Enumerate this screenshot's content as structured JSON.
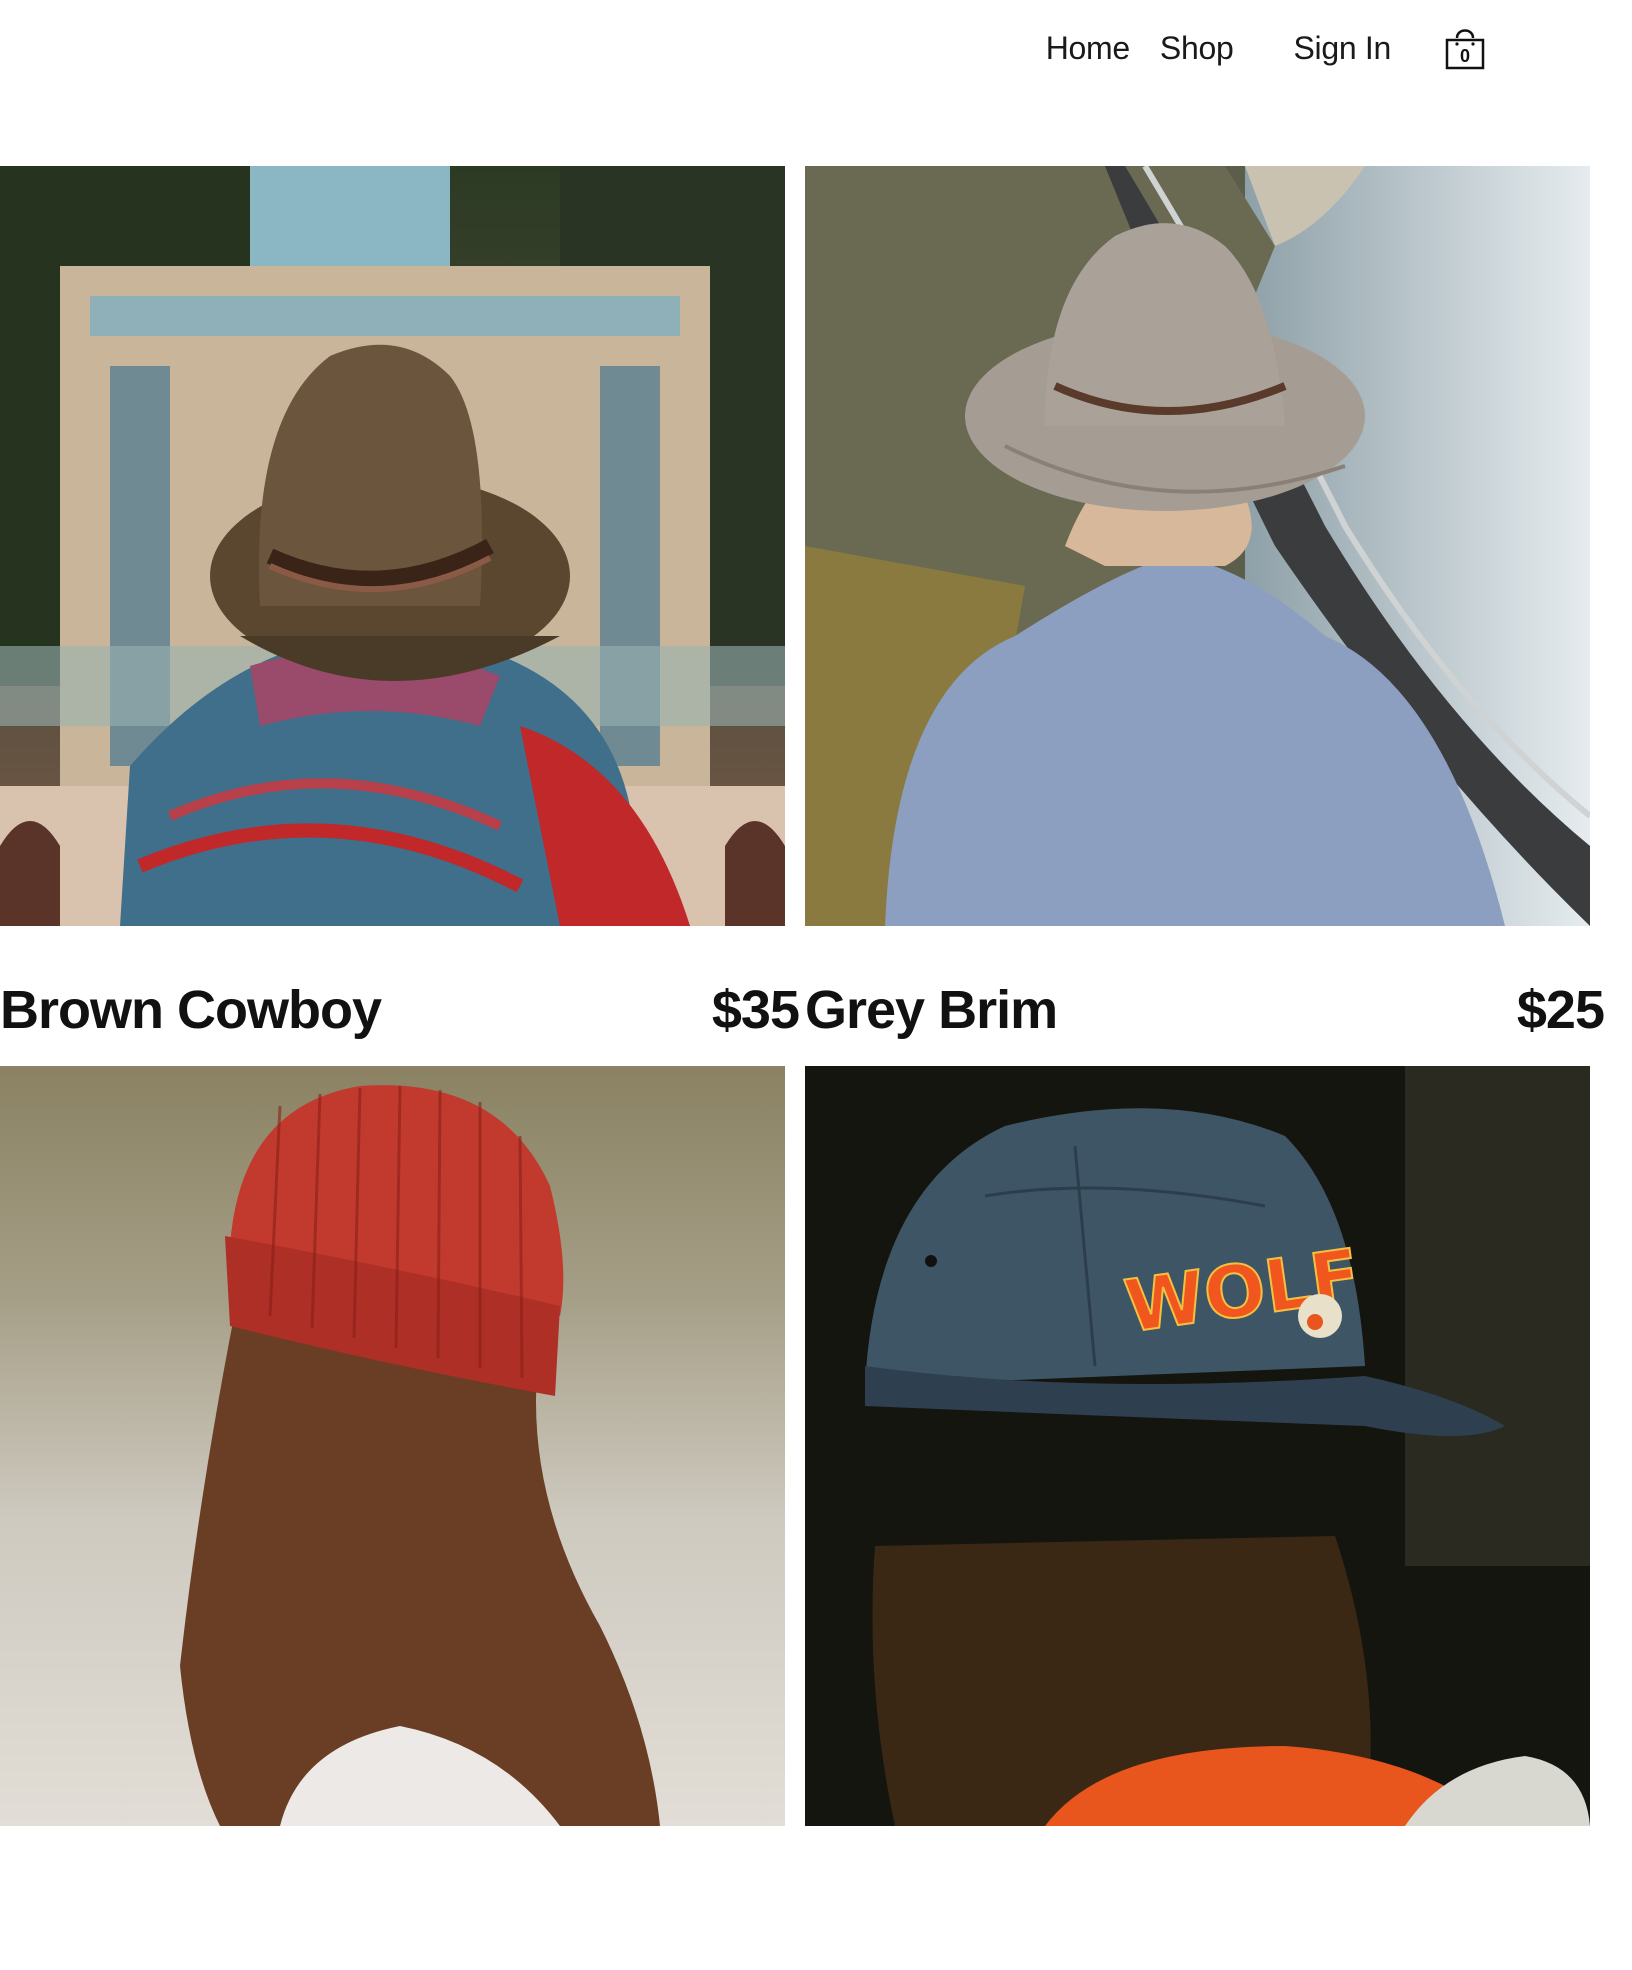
{
  "nav": {
    "home_label": "Home",
    "shop_label": "Shop",
    "signin_label": "Sign In",
    "cart_count": "0",
    "cart_icon": "shopping-bag-icon"
  },
  "products": [
    {
      "name": "Brown Cowboy",
      "price": "$35",
      "image": "person-in-brown-cowboy-hat-photo"
    },
    {
      "name": "Grey Brim",
      "price": "$25",
      "image": "person-in-grey-brim-hat-photo"
    },
    {
      "name": "",
      "price": "",
      "image": "person-in-red-beanie-photo"
    },
    {
      "name": "",
      "price": "",
      "image": "person-in-navy-wolf-cap-photo"
    }
  ],
  "colors": {
    "text": "#111111",
    "background": "#ffffff"
  }
}
